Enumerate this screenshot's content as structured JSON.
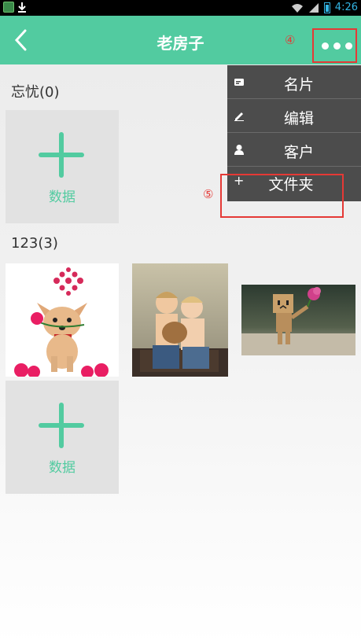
{
  "status_bar": {
    "time": "4:26",
    "icons": [
      "app-icon",
      "download-icon",
      "wifi-icon",
      "signal-icon",
      "battery-icon"
    ]
  },
  "app_bar": {
    "title": "老房子",
    "back_icon": "chevron-left-icon",
    "more_icon": "more-dots-icon",
    "color": "#52cba0"
  },
  "annotations": {
    "more_marker": "④",
    "folder_marker": "⑤",
    "highlight_color": "#e53935"
  },
  "sections": [
    {
      "title": "忘忧(0)",
      "add_label": "数据"
    },
    {
      "title": "123(3)",
      "add_label": "数据"
    }
  ],
  "thumbnails": [
    {
      "name": "chihuahua-with-rose-photo",
      "subject": "dog"
    },
    {
      "name": "two-children-photo",
      "subject": "children"
    },
    {
      "name": "cardboard-robot-flower-photo",
      "subject": "robot"
    }
  ],
  "menu": {
    "items": [
      {
        "label": "名片",
        "icon": "card-icon"
      },
      {
        "label": "编辑",
        "icon": "pencil-icon"
      },
      {
        "label": "客户",
        "icon": "person-icon"
      },
      {
        "label": "文件夹",
        "icon": "plus-icon",
        "icon_glyph": "+"
      }
    ]
  }
}
